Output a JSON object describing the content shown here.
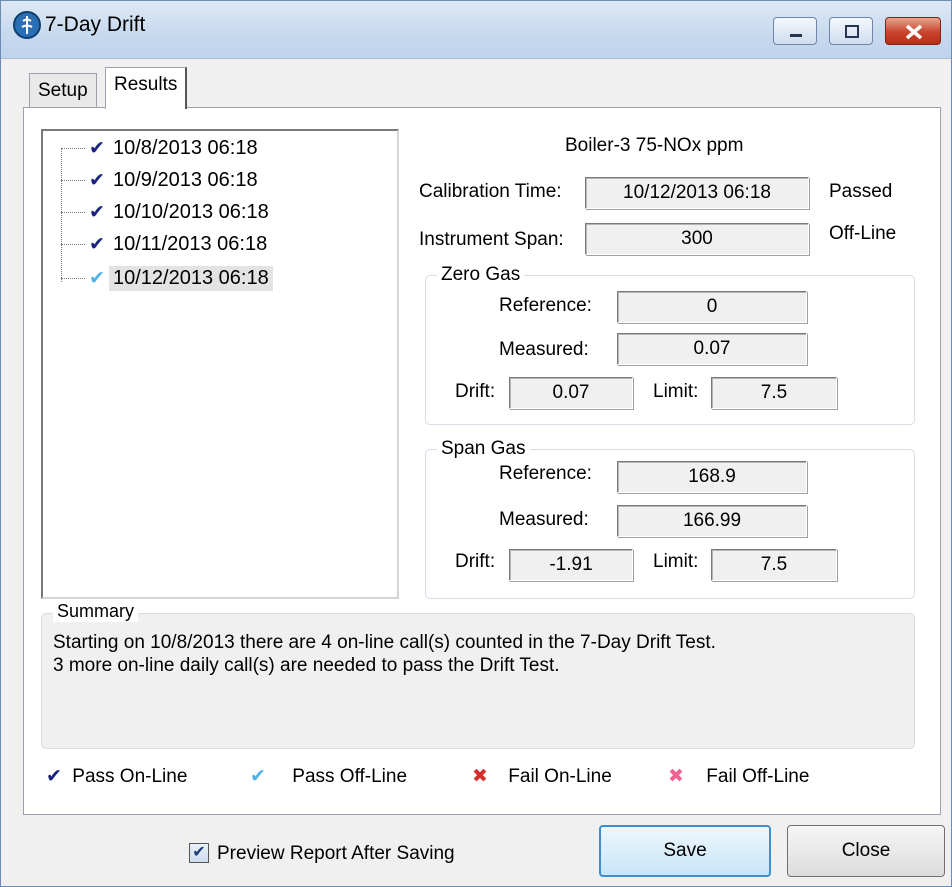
{
  "window": {
    "title": "7-Day Drift"
  },
  "tabs": [
    {
      "label": "Setup"
    },
    {
      "label": "Results"
    }
  ],
  "dates": [
    {
      "label": "10/8/2013 06:18",
      "status": "pass-online"
    },
    {
      "label": "10/9/2013 06:18",
      "status": "pass-online"
    },
    {
      "label": "10/10/2013 06:18",
      "status": "pass-online"
    },
    {
      "label": "10/11/2013 06:18",
      "status": "pass-online"
    },
    {
      "label": "10/12/2013 06:18",
      "status": "pass-offline",
      "selected": true
    }
  ],
  "details": {
    "heading": "Boiler-3 75-NOx ppm",
    "calibration_time_label": "Calibration Time:",
    "calibration_time": "10/12/2013 06:18",
    "result": "Passed",
    "instrument_span_label": "Instrument Span:",
    "instrument_span": "300",
    "mode": "Off-Line",
    "zero_gas": {
      "title": "Zero Gas",
      "reference_label": "Reference:",
      "reference": "0",
      "measured_label": "Measured:",
      "measured": "0.07",
      "drift_label": "Drift:",
      "drift": "0.07",
      "limit_label": "Limit:",
      "limit": "7.5"
    },
    "span_gas": {
      "title": "Span Gas",
      "reference_label": "Reference:",
      "reference": "168.9",
      "measured_label": "Measured:",
      "measured": "166.99",
      "drift_label": "Drift:",
      "drift": "-1.91",
      "limit_label": "Limit:",
      "limit": "7.5"
    }
  },
  "summary": {
    "title": "Summary",
    "line1": "Starting on 10/8/2013 there are 4 on-line call(s) counted in the 7-Day Drift Test.",
    "line2": "3 more on-line daily call(s) are needed to pass the Drift Test."
  },
  "legend": [
    {
      "label": "Pass On-Line",
      "icon": "check-icon",
      "color": "#1a237e"
    },
    {
      "label": "Pass Off-Line",
      "icon": "check-icon",
      "color": "#4fb3e8"
    },
    {
      "label": "Fail On-Line",
      "icon": "x-icon",
      "color": "#d32f2f"
    },
    {
      "label": "Fail Off-Line",
      "icon": "x-icon",
      "color": "#f06292"
    }
  ],
  "footer": {
    "preview_label": "Preview Report After Saving",
    "preview_checked": true,
    "save_label": "Save",
    "close_label": "Close"
  }
}
